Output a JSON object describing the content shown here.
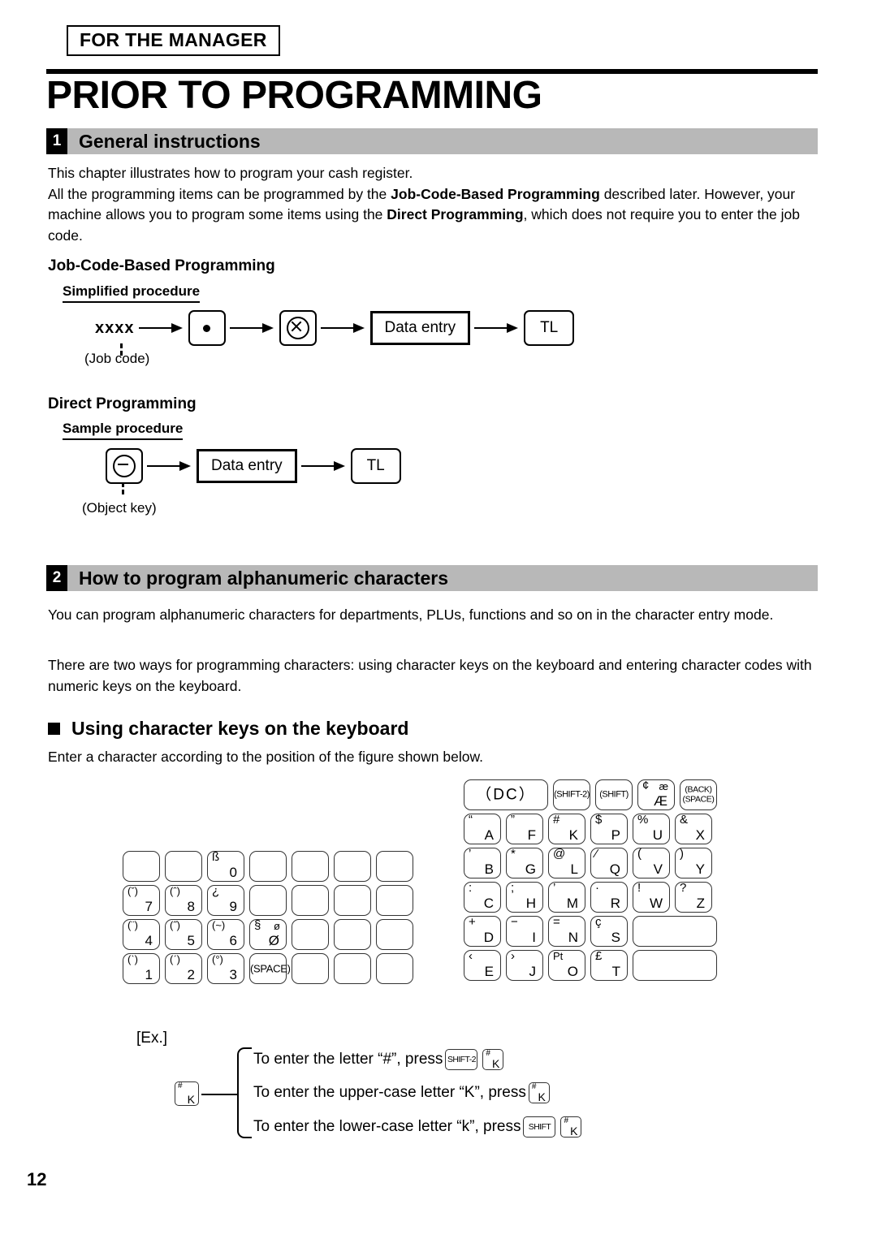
{
  "header": {
    "manager_tag": "FOR THE MANAGER",
    "doc_title": "PRIOR TO PROGRAMMING"
  },
  "sections": [
    {
      "number": "1",
      "title": "General instructions"
    },
    {
      "number": "2",
      "title": "How to program alphanumeric characters"
    }
  ],
  "general": {
    "para1_line1": "This chapter illustrates how to program your cash register.",
    "para1_a": "All the programming items can be programmed by the ",
    "para1_b1": "Job-Code-Based Programming",
    "para1_c": " described later. However, your machine allows you to program some items using the ",
    "para1_b2": "Direct Programming",
    "para1_d": ", which does not require you to enter the job code."
  },
  "job_code_based": {
    "heading": "Job-Code-Based Programming",
    "sub_heading": "Simplified procedure",
    "step_xxxx": "xxxx",
    "caption_job_code": "(Job code)",
    "key_dot": "dot-key",
    "key_multiply": "multiply-key",
    "data_entry": "Data entry",
    "key_tl": "TL"
  },
  "direct_programming": {
    "heading": "Direct Programming",
    "sub_heading": "Sample procedure",
    "key_minus": "minus-key",
    "caption_object_key": "(Object key)",
    "data_entry": "Data entry",
    "key_tl": "TL"
  },
  "alphanumeric": {
    "para1": "You can program alphanumeric characters for departments, PLUs, functions and so on in the character entry mode.",
    "para2": "There are two ways for programming characters: using character keys on the keyboard and entering character codes with numeric keys on the keyboard.",
    "bullet_heading": "Using character keys on the keyboard",
    "para3": "Enter a character according to the position of the figure shown below."
  },
  "keyboard": {
    "left_block": [
      [
        {
          "blank": true
        },
        {
          "blank": true
        },
        {
          "tl": "ß",
          "br": "0"
        },
        {
          "blank": true
        },
        {
          "blank": true
        },
        {
          "blank": true
        },
        {
          "blank": true
        }
      ],
      [
        {
          "tl": "(ˇ)",
          "br": "7"
        },
        {
          "tl": "(ˆ)",
          "br": "8"
        },
        {
          "tl": "¿",
          "br": "9"
        },
        {
          "blank": true
        },
        {
          "blank": true
        },
        {
          "blank": true
        },
        {
          "blank": true
        }
      ],
      [
        {
          "tl": "(¨)",
          "br": "4"
        },
        {
          "tl": "(˝)",
          "br": "5"
        },
        {
          "tl": "(~)",
          "br": "6"
        },
        {
          "tl": "§",
          "tr": "ø",
          "br": "Ø"
        },
        {
          "blank": true
        },
        {
          "blank": true
        },
        {
          "blank": true
        }
      ],
      [
        {
          "tl": "(ˋ)",
          "br": "1"
        },
        {
          "tl": "(ˊ)",
          "br": "2"
        },
        {
          "tl": "(°)",
          "br": "3"
        },
        {
          "ctr": "(SPACE)"
        },
        {
          "blank": true
        },
        {
          "blank": true
        },
        {
          "blank": true
        }
      ]
    ],
    "right_block": [
      [
        {
          "ctr": "（DC）",
          "wide": true,
          "dc": true
        },
        {
          "ctr": "(SHIFT-2)",
          "small": true
        },
        {
          "ctr": "(SHIFT)",
          "small": true
        },
        {
          "tl": "¢",
          "tr": "æ",
          "br": "Æ"
        },
        {
          "two": "(BACK)|(SPACE)"
        }
      ],
      [
        {
          "tl": "“",
          "br": "A"
        },
        {
          "tl": "”",
          "br": "F"
        },
        {
          "tl": "#",
          "br": "K"
        },
        {
          "tl": "$",
          "br": "P"
        },
        {
          "tl": "%",
          "br": "U"
        },
        {
          "tl": "&",
          "br": "X"
        }
      ],
      [
        {
          "tl": "’",
          "br": "B"
        },
        {
          "tl": "*",
          "br": "G"
        },
        {
          "tl": "@",
          "br": "L"
        },
        {
          "tl": "⁄",
          "br": "Q"
        },
        {
          "tl": "(",
          "br": "V"
        },
        {
          "tl": ")",
          "br": "Y"
        }
      ],
      [
        {
          "tl": ":",
          "br": "C"
        },
        {
          "tl": ";",
          "br": "H"
        },
        {
          "tl": "’",
          "br": "M"
        },
        {
          "tl": "·",
          "br": "R"
        },
        {
          "tl": "!",
          "br": "W"
        },
        {
          "tl": "?",
          "br": "Z"
        }
      ],
      [
        {
          "tl": "+",
          "br": "D"
        },
        {
          "tl": "−",
          "br": "I"
        },
        {
          "tl": "=",
          "br": "N"
        },
        {
          "tl": "ç",
          "br": "S"
        },
        {
          "blank": true,
          "wide": true
        }
      ],
      [
        {
          "tl": "‹",
          "br": "E"
        },
        {
          "tl": "›",
          "br": "J"
        },
        {
          "tl": "Pt",
          "br": "O"
        },
        {
          "tl": "£",
          "br": "T"
        },
        {
          "blank": true,
          "wide": true
        }
      ]
    ]
  },
  "example": {
    "label": "[Ex.]",
    "source_key": {
      "tl": "#",
      "br": "K"
    },
    "lines": [
      {
        "text_before": "To enter the letter “#”, press",
        "keys": [
          {
            "label": "SHIFT-2"
          },
          {
            "tl": "#",
            "br": "K"
          }
        ]
      },
      {
        "text_before": "To enter the upper-case letter “K”, press",
        "keys": [
          {
            "tl": "#",
            "br": "K"
          }
        ]
      },
      {
        "text_before": "To enter the lower-case letter “k”, press",
        "keys": [
          {
            "label": "SHIFT"
          },
          {
            "tl": "#",
            "br": "K"
          }
        ]
      }
    ]
  },
  "footer": {
    "page_number": "12"
  },
  "colors": {
    "section_bar": "#b8b8b8",
    "section_num_bg": "#000000",
    "text": "#000000",
    "page_bg": "#ffffff"
  }
}
